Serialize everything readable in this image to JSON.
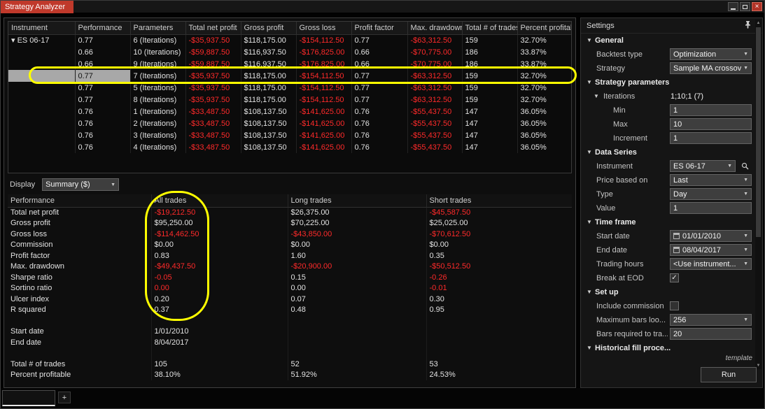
{
  "colors": {
    "title_tab": "#c0392b",
    "negative_value": "#ff2a2a",
    "annotation": "#ffff00"
  },
  "titlebar": {
    "title": "Strategy Analyzer",
    "close_icon": "×"
  },
  "icons": {
    "chevron_down": "▼",
    "expander_open": "▼",
    "sort_ascending": "▲",
    "check": "✓",
    "scroll_up": "▲",
    "scroll_down": "▼"
  },
  "main_table": {
    "headers": [
      "Instrument",
      "Performance",
      "Parameters",
      "Total net profit",
      "Gross profit",
      "Gross loss",
      "Profit factor",
      "Max. drawdown",
      "Total # of trades",
      "Percent profitab"
    ],
    "rows": [
      {
        "cells": [
          "▾ ES 06-17",
          "0.77",
          "6 (Iterations)",
          "-$35,937.50",
          "$118,175.00",
          "-$154,112.50",
          "0.77",
          "-$63,312.50",
          "159",
          "32.70%"
        ]
      },
      {
        "cells": [
          "",
          "0.66",
          "10 (Iterations)",
          "-$59,887.50",
          "$116,937.50",
          "-$176,825.00",
          "0.66",
          "-$70,775.00",
          "186",
          "33.87%"
        ]
      },
      {
        "cells": [
          "",
          "0.66",
          "9 (Iterations)",
          "-$59,887.50",
          "$116,937.50",
          "-$176,825.00",
          "0.66",
          "-$70,775.00",
          "186",
          "33.87%"
        ]
      },
      {
        "cells": [
          "",
          "0.77",
          "7 (Iterations)",
          "-$35,937.50",
          "$118,175.00",
          "-$154,112.50",
          "0.77",
          "-$63,312.50",
          "159",
          "32.70%"
        ],
        "selected": true
      },
      {
        "cells": [
          "",
          "0.77",
          "5 (Iterations)",
          "-$35,937.50",
          "$118,175.00",
          "-$154,112.50",
          "0.77",
          "-$63,312.50",
          "159",
          "32.70%"
        ]
      },
      {
        "cells": [
          "",
          "0.77",
          "8 (Iterations)",
          "-$35,937.50",
          "$118,175.00",
          "-$154,112.50",
          "0.77",
          "-$63,312.50",
          "159",
          "32.70%"
        ]
      },
      {
        "cells": [
          "",
          "0.76",
          "1 (Iterations)",
          "-$33,487.50",
          "$108,137.50",
          "-$141,625.00",
          "0.76",
          "-$55,437.50",
          "147",
          "36.05%"
        ]
      },
      {
        "cells": [
          "",
          "0.76",
          "2 (Iterations)",
          "-$33,487.50",
          "$108,137.50",
          "-$141,625.00",
          "0.76",
          "-$55,437.50",
          "147",
          "36.05%"
        ]
      },
      {
        "cells": [
          "",
          "0.76",
          "3 (Iterations)",
          "-$33,487.50",
          "$108,137.50",
          "-$141,625.00",
          "0.76",
          "-$55,437.50",
          "147",
          "36.05%"
        ]
      },
      {
        "cells": [
          "",
          "0.76",
          "4 (Iterations)",
          "-$33,487.50",
          "$108,137.50",
          "-$141,625.00",
          "0.76",
          "-$55,437.50",
          "147",
          "36.05%"
        ]
      }
    ]
  },
  "display_bar": {
    "label": "Display",
    "selected": "Summary ($)"
  },
  "summary_table": {
    "headers": [
      "Performance",
      "All trades",
      "Long trades",
      "Short trades"
    ],
    "rows": [
      {
        "cells": [
          "Total net profit",
          "-$19,212.50",
          "$26,375.00",
          "-$45,587.50"
        ]
      },
      {
        "cells": [
          "Gross profit",
          "$95,250.00",
          "$70,225.00",
          "$25,025.00"
        ]
      },
      {
        "cells": [
          "Gross loss",
          "-$114,462.50",
          "-$43,850.00",
          "-$70,612.50"
        ]
      },
      {
        "cells": [
          "Commission",
          "$0.00",
          "$0.00",
          "$0.00"
        ]
      },
      {
        "cells": [
          "Profit factor",
          "0.83",
          "1.60",
          "0.35"
        ]
      },
      {
        "cells": [
          "Max. drawdown",
          "-$49,437.50",
          "-$20,900.00",
          "-$50,512.50"
        ]
      },
      {
        "cells": [
          "Sharpe ratio",
          "-0.05",
          "0.15",
          "-0.26"
        ]
      },
      {
        "cells": [
          "Sortino ratio",
          {
            "t": "0.00",
            "neg": true
          },
          "0.00",
          "-0.01"
        ]
      },
      {
        "cells": [
          "Ulcer index",
          "0.20",
          "0.07",
          "0.30"
        ]
      },
      {
        "cells": [
          "R squared",
          "0.37",
          "0.48",
          "0.95"
        ]
      },
      {
        "cells": [
          "",
          "",
          "",
          ""
        ]
      },
      {
        "cells": [
          "Start date",
          "1/01/2010",
          "",
          ""
        ]
      },
      {
        "cells": [
          "End date",
          "8/04/2017",
          "",
          ""
        ]
      },
      {
        "cells": [
          "",
          "",
          "",
          ""
        ]
      },
      {
        "cells": [
          "Total # of trades",
          "105",
          "52",
          "53"
        ]
      },
      {
        "cells": [
          "Percent profitable",
          "38.10%",
          "51.92%",
          "24.53%"
        ]
      }
    ]
  },
  "settings": {
    "title": "Settings",
    "sections": {
      "general": "General",
      "strategy_parameters": "Strategy parameters",
      "data_series": "Data Series",
      "time_frame": "Time frame",
      "set_up": "Set up",
      "historical_fill": "Historical fill proce..."
    },
    "fields": {
      "backtest_type": {
        "label": "Backtest type",
        "value": "Optimization"
      },
      "strategy": {
        "label": "Strategy",
        "value": "Sample MA crossove"
      },
      "iterations": {
        "label": "Iterations",
        "value": "1;10;1 (7)"
      },
      "min": {
        "label": "Min",
        "value": "1"
      },
      "max": {
        "label": "Max",
        "value": "10"
      },
      "increment": {
        "label": "Increment",
        "value": "1"
      },
      "instrument": {
        "label": "Instrument",
        "value": "ES 06-17"
      },
      "price_based_on": {
        "label": "Price based on",
        "value": "Last"
      },
      "type": {
        "label": "Type",
        "value": "Day"
      },
      "value": {
        "label": "Value",
        "value": "1"
      },
      "start_date": {
        "label": "Start date",
        "value": "01/01/2010"
      },
      "end_date": {
        "label": "End date",
        "value": "08/04/2017"
      },
      "trading_hours": {
        "label": "Trading hours",
        "value": "<Use instrument..."
      },
      "break_at_eod": {
        "label": "Break at EOD"
      },
      "include_commission": {
        "label": "Include commission"
      },
      "max_bars": {
        "label": "Maximum bars loo...",
        "value": "256"
      },
      "bars_required": {
        "label": "Bars required to tra...",
        "value": "20"
      }
    },
    "template_link": "template",
    "run_button": "Run"
  },
  "tabs": {
    "tab_label": "",
    "add_label": "+"
  }
}
